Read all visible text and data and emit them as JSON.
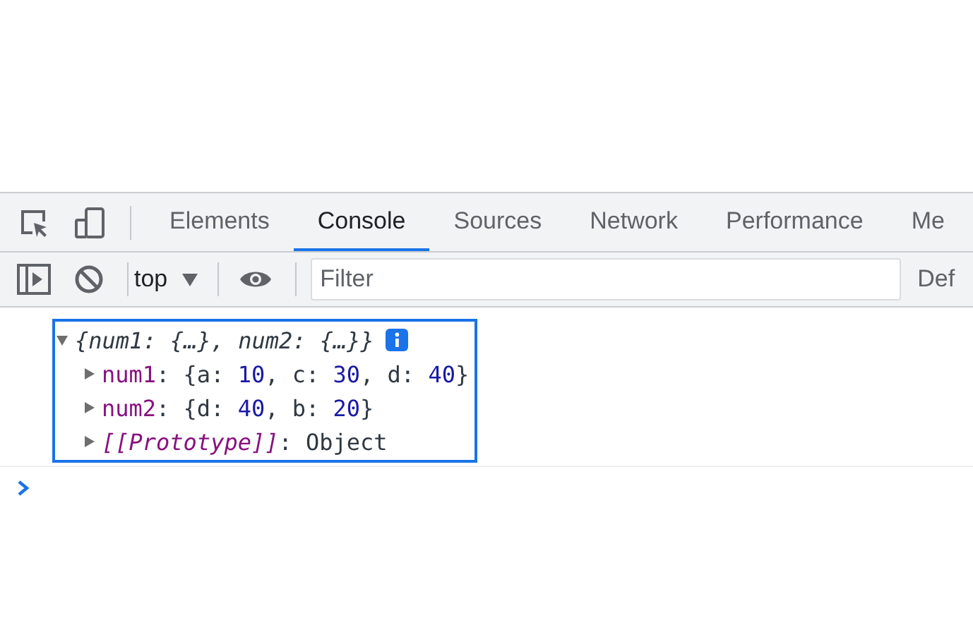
{
  "tabs": [
    {
      "label": "Elements",
      "selected": false
    },
    {
      "label": "Console",
      "selected": true
    },
    {
      "label": "Sources",
      "selected": false
    },
    {
      "label": "Network",
      "selected": false
    },
    {
      "label": "Performance",
      "selected": false
    },
    {
      "label": "Me",
      "selected": false
    }
  ],
  "toolbar": {
    "context": "top",
    "filter": {
      "placeholder": "Filter"
    },
    "levels": "Def"
  },
  "console": {
    "entry": {
      "summary": "{num1: {…}, num2: {…}}",
      "expanded": true,
      "highlighted": true,
      "properties": [
        {
          "key": "num1",
          "kind": "own",
          "expanded": false,
          "value": [
            {
              "kind": "text",
              "text": ": {a: "
            },
            {
              "kind": "number",
              "text": "10"
            },
            {
              "kind": "text",
              "text": ", c: "
            },
            {
              "kind": "number",
              "text": "30"
            },
            {
              "kind": "text",
              "text": ", d: "
            },
            {
              "kind": "number",
              "text": "40"
            },
            {
              "kind": "text",
              "text": "}"
            }
          ]
        },
        {
          "key": "num2",
          "kind": "own",
          "expanded": false,
          "value": [
            {
              "kind": "text",
              "text": ": {d: "
            },
            {
              "kind": "number",
              "text": "40"
            },
            {
              "kind": "text",
              "text": ", b: "
            },
            {
              "kind": "number",
              "text": "20"
            },
            {
              "kind": "text",
              "text": "}"
            }
          ]
        },
        {
          "key": "[[Prototype]]",
          "kind": "internal",
          "expanded": false,
          "value": [
            {
              "kind": "text",
              "text": ": Object"
            }
          ]
        }
      ]
    }
  }
}
